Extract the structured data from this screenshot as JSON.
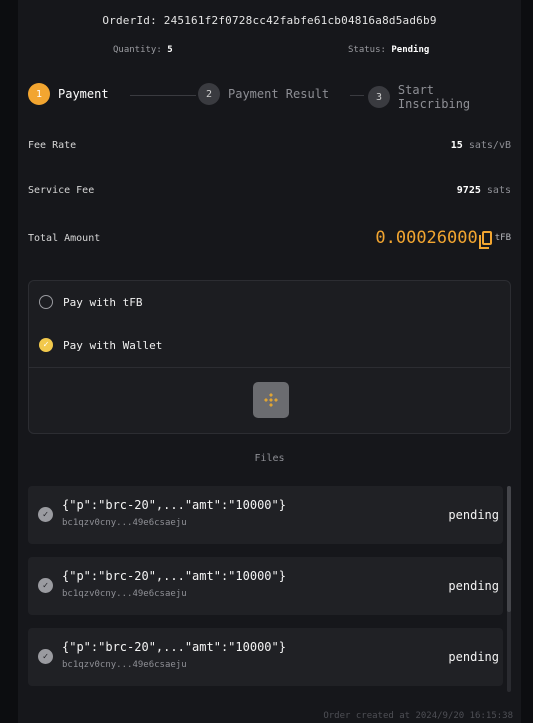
{
  "order": {
    "id_label": "OrderId: 245161f2f0728cc42fabfe61cb04816a8d5ad6b9",
    "quantity_label": "Quantity:",
    "quantity_value": "5",
    "status_label": "Status:",
    "status_value": "Pending"
  },
  "steps": [
    {
      "num": "1",
      "label": "Payment"
    },
    {
      "num": "2",
      "label": "Payment Result"
    },
    {
      "num": "3",
      "label": "Start Inscribing"
    }
  ],
  "fees": {
    "fee_rate_label": "Fee Rate",
    "fee_rate_value": "15",
    "fee_rate_unit": "sats/vB",
    "service_fee_label": "Service Fee",
    "service_fee_value": "9725",
    "service_fee_unit": "sats",
    "total_label": "Total Amount",
    "total_value": "0.00026000",
    "total_unit": "tFB"
  },
  "payment": {
    "option_tfb": "Pay with tFB",
    "option_wallet": "Pay with Wallet",
    "selected": "Pay with Wallet"
  },
  "files": {
    "label": "Files",
    "items": [
      {
        "name": "{\"p\":\"brc-20\",...\"amt\":\"10000\"}",
        "address": "bc1qzv0cny...49e6csaeju",
        "status": "pending"
      },
      {
        "name": "{\"p\":\"brc-20\",...\"amt\":\"10000\"}",
        "address": "bc1qzv0cny...49e6csaeju",
        "status": "pending"
      },
      {
        "name": "{\"p\":\"brc-20\",...\"amt\":\"10000\"}",
        "address": "bc1qzv0cny...49e6csaeju",
        "status": "pending"
      }
    ]
  },
  "footer": {
    "created": "Order created at 2024/9/20 16:15:38"
  },
  "colors": {
    "accent": "#f2a530",
    "background": "#16171b",
    "card": "#202125"
  }
}
